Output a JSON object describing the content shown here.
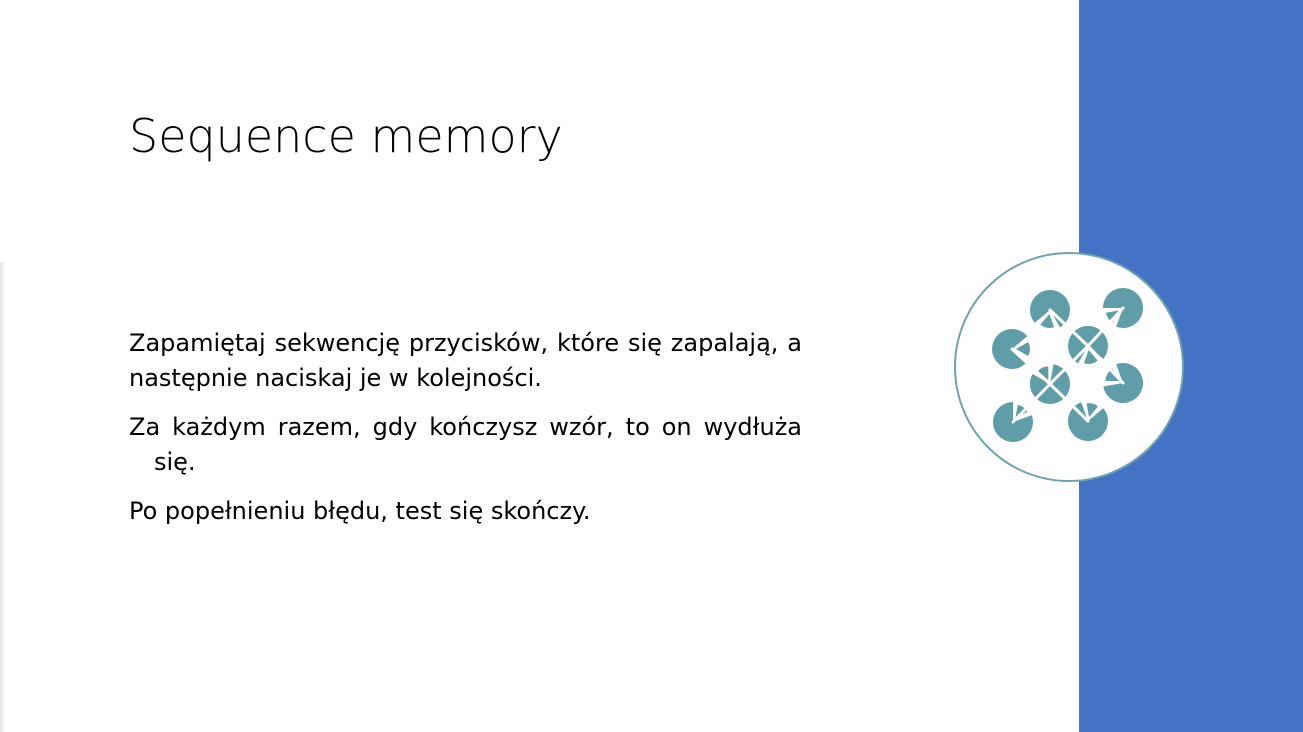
{
  "slide": {
    "title": "Sequence memory",
    "paragraphs": [
      "Zapamiętaj sekwencję przycisków, które się zapalają, a następnie naciskaj je w kolejności.",
      "Za każdym razem, gdy kończysz wzór, to on wydłuża się.",
      "Po popełnieniu błędu, test się skończy."
    ]
  },
  "colors": {
    "accent": "#4472c4",
    "icon_teal": "#5f9ea9",
    "circle_border": "#6ea3ad",
    "text": "#000000",
    "background": "#ffffff"
  },
  "icon": {
    "name": "network-pie-icon"
  }
}
